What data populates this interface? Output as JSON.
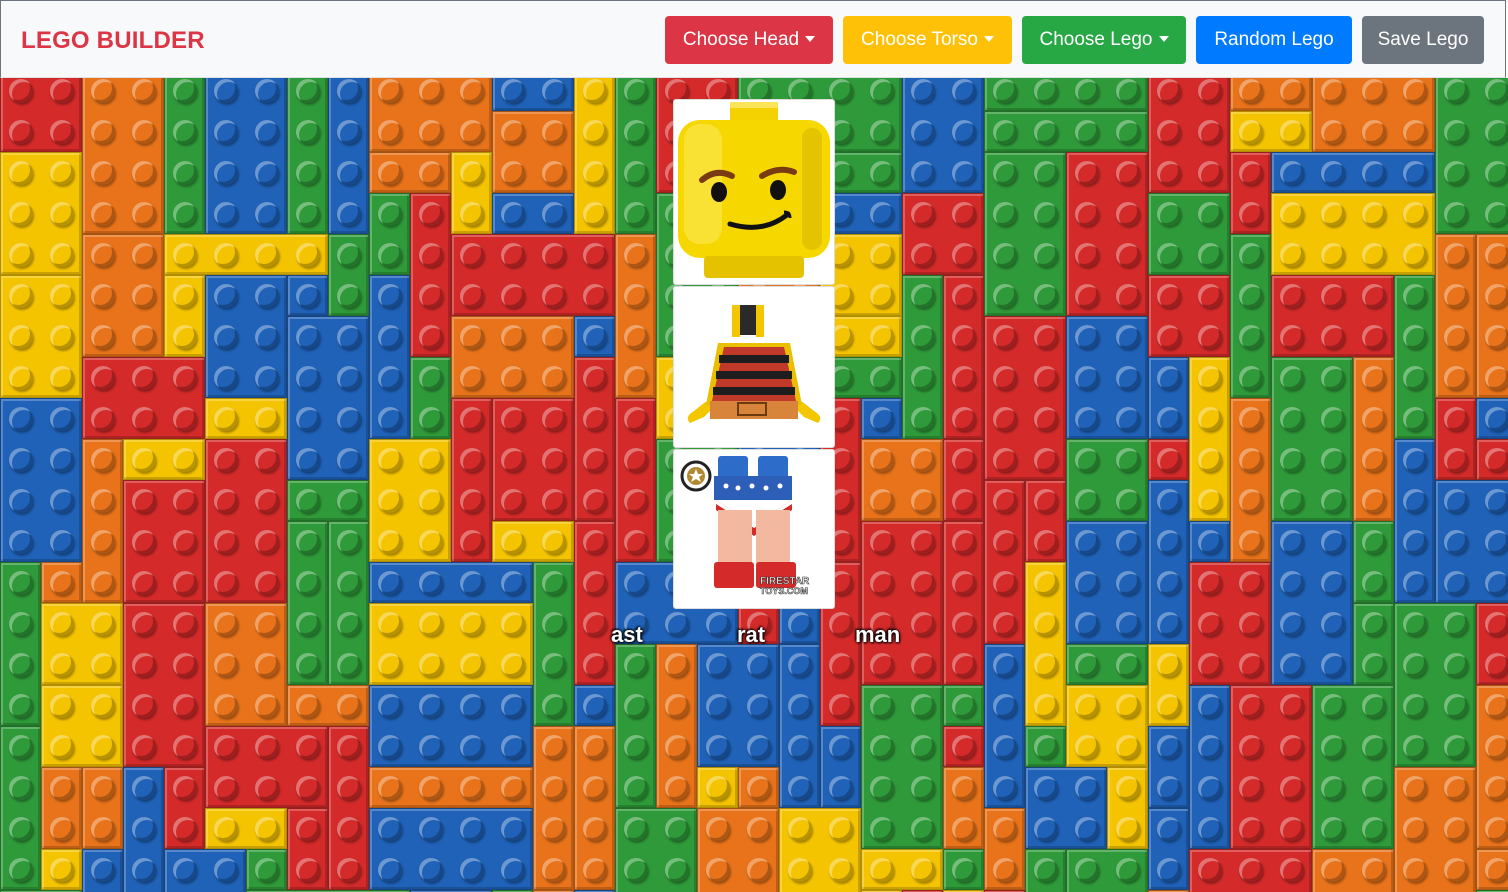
{
  "navbar": {
    "brand": "LEGO BUILDER",
    "choose_head_label": "Choose Head",
    "choose_torso_label": "Choose Torso",
    "choose_lego_label": "Choose Lego",
    "random_lego_label": "Random Lego",
    "save_lego_label": "Save Lego"
  },
  "figure": {
    "head_name": "ast",
    "torso_name": "rat",
    "legs_name": "man",
    "legs_watermark_line1": "FIRESTAR",
    "legs_watermark_line2": "TOYS.COM"
  },
  "colors": {
    "head_button": "#dc3545",
    "torso_button": "#ffc107",
    "lego_button": "#28a745",
    "random_button": "#007bff",
    "save_button": "#6c757d",
    "brand": "#dc3545",
    "brick_palette": [
      "#f5c400",
      "#e8731a",
      "#2f9a3a",
      "#1f62b8",
      "#d42a2a"
    ]
  },
  "icons": {
    "dropdown": "caret-down-icon"
  }
}
